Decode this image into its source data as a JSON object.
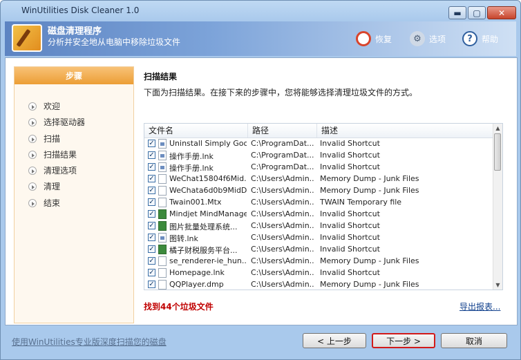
{
  "window": {
    "title": "WinUtilities Disk Cleaner 1.0",
    "controls": {
      "minimize": "▬",
      "maximize": "▢",
      "close": "✕"
    }
  },
  "header": {
    "title": "磁盘清理程序",
    "subtitle": "分析并安全地从电脑中移除垃圾文件",
    "actions": [
      {
        "label": "恢复",
        "icon": "restore-icon"
      },
      {
        "label": "选项",
        "icon": "gear-icon"
      },
      {
        "label": "帮助",
        "icon": "help-icon"
      }
    ]
  },
  "steps": {
    "heading": "步骤",
    "items": [
      "欢迎",
      "选择驱动器",
      "扫描",
      "扫描结果",
      "清理选项",
      "清理",
      "结束"
    ]
  },
  "main": {
    "title": "扫描结果",
    "description": "下面为扫描结果。在接下来的步骤中，您将能够选择清理垃圾文件的方式。",
    "columns": [
      "文件名",
      "路径",
      "描述"
    ],
    "rows": [
      {
        "name": "Uninstall Simply Goo...",
        "path": "C:\\ProgramDat...",
        "desc": "Invalid Shortcut",
        "icon": "shortcut"
      },
      {
        "name": "操作手册.lnk",
        "path": "C:\\ProgramDat...",
        "desc": "Invalid Shortcut",
        "icon": "shortcut"
      },
      {
        "name": "操作手册.lnk",
        "path": "C:\\ProgramDat...",
        "desc": "Invalid Shortcut",
        "icon": "shortcut"
      },
      {
        "name": "WeChat15804f6Mid...",
        "path": "C:\\Users\\Admin...",
        "desc": "Memory Dump - Junk Files",
        "icon": "file"
      },
      {
        "name": "WeChata6d0b9MidD...",
        "path": "C:\\Users\\Admin...",
        "desc": "Memory Dump - Junk Files",
        "icon": "file"
      },
      {
        "name": "Twain001.Mtx",
        "path": "C:\\Users\\Admin...",
        "desc": "TWAIN Temporary file",
        "icon": "file"
      },
      {
        "name": "Mindjet MindManage...",
        "path": "C:\\Users\\Admin...",
        "desc": "Invalid Shortcut",
        "icon": "app"
      },
      {
        "name": "图片批量处理系统...",
        "path": "C:\\Users\\Admin...",
        "desc": "Invalid Shortcut",
        "icon": "app"
      },
      {
        "name": "图转.lnk",
        "path": "C:\\Users\\Admin...",
        "desc": "Invalid Shortcut",
        "icon": "shortcut"
      },
      {
        "name": "橘子财税服务平台...",
        "path": "C:\\Users\\Admin...",
        "desc": "Invalid Shortcut",
        "icon": "app"
      },
      {
        "name": "se_renderer-ie_hun...",
        "path": "C:\\Users\\Admin...",
        "desc": "Memory Dump - Junk Files",
        "icon": "file"
      },
      {
        "name": "Homepage.lnk",
        "path": "C:\\Users\\Admin...",
        "desc": "Invalid Shortcut",
        "icon": "file"
      },
      {
        "name": "QQPlayer.dmp",
        "path": "C:\\Users\\Admin...",
        "desc": "Memory Dump - Junk Files",
        "icon": "file"
      }
    ],
    "found_text": "找到44个垃圾文件",
    "export_link": "导出报表..."
  },
  "footer": {
    "deep_scan_link": "使用WinUtilities专业版深度扫描您的磁盘",
    "prev_button": "< 上一步",
    "next_button": "下一步 >",
    "cancel_button": "取消"
  },
  "colors": {
    "accent": "#ec9e35",
    "highlight_border": "#d21a1a",
    "found_text": "#c00000",
    "banner": "#5d84c2"
  }
}
